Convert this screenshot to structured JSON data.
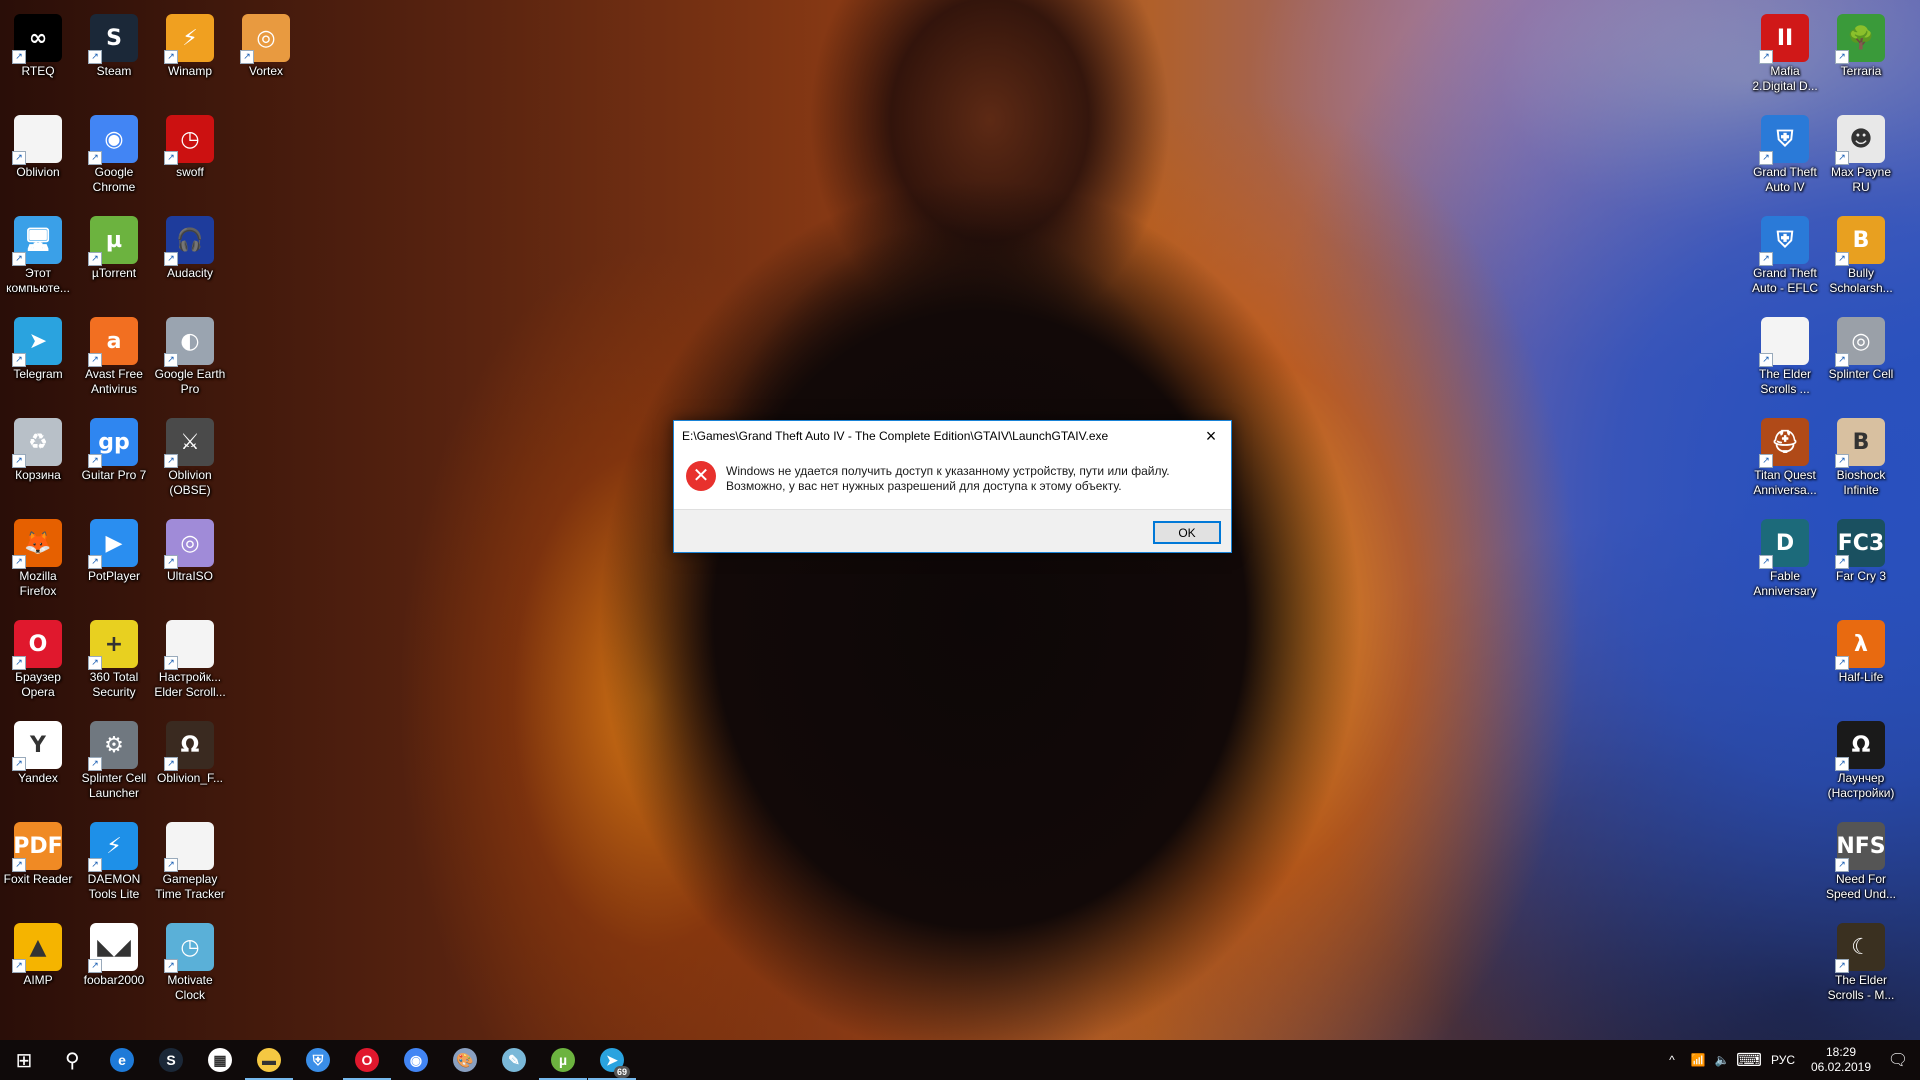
{
  "desktop": {
    "left_icons": [
      {
        "label": "RTEQ",
        "icon": "rteq-equalizer-icon",
        "color": "#000000",
        "glyph": "∞"
      },
      {
        "label": "Steam",
        "icon": "steam-icon",
        "color": "#1b2838",
        "glyph": "S"
      },
      {
        "label": "Winamp",
        "icon": "winamp-icon",
        "color": "#f0a020",
        "glyph": "⚡"
      },
      {
        "label": "Vortex",
        "icon": "vortex-icon",
        "color": "#e89a40",
        "glyph": "◎"
      },
      {
        "label": "Oblivion",
        "icon": "blank-file-icon",
        "color": "#f4f4f4",
        "glyph": ""
      },
      {
        "label": "Google Chrome",
        "icon": "chrome-icon",
        "color": "#4285f4",
        "glyph": "◉"
      },
      {
        "label": "swoff",
        "icon": "swoff-clock-icon",
        "color": "#cc1111",
        "glyph": "◷"
      },
      {
        "label": "Этот компьюте...",
        "icon": "this-pc-icon",
        "color": "#3aa0e8",
        "glyph": "🖥"
      },
      {
        "label": "µTorrent",
        "icon": "utorrent-icon",
        "color": "#6cb33f",
        "glyph": "µ"
      },
      {
        "label": "Audacity",
        "icon": "audacity-icon",
        "color": "#1e3c9c",
        "glyph": "🎧"
      },
      {
        "label": "Telegram",
        "icon": "telegram-icon",
        "color": "#2aa3df",
        "glyph": "➤"
      },
      {
        "label": "Avast Free Antivirus",
        "icon": "avast-icon",
        "color": "#f26f21",
        "glyph": "a"
      },
      {
        "label": "Google Earth Pro",
        "icon": "google-earth-icon",
        "color": "#9aa4b0",
        "glyph": "◐"
      },
      {
        "label": "Корзина",
        "icon": "recycle-bin-icon",
        "color": "#b8c0c8",
        "glyph": "♻"
      },
      {
        "label": "Guitar Pro 7",
        "icon": "guitar-pro-icon",
        "color": "#2f86f0",
        "glyph": "gp"
      },
      {
        "label": "Oblivion (OBSE)",
        "icon": "oblivion-obse-icon",
        "color": "#4a4a4a",
        "glyph": "⚔"
      },
      {
        "label": "Mozilla Firefox",
        "icon": "firefox-icon",
        "color": "#e66000",
        "glyph": "🦊"
      },
      {
        "label": "PotPlayer",
        "icon": "potplayer-icon",
        "color": "#2a8ef0",
        "glyph": "▶"
      },
      {
        "label": "UltraISO",
        "icon": "ultraiso-icon",
        "color": "#a08bd8",
        "glyph": "◎"
      },
      {
        "label": "Браузер Opera",
        "icon": "opera-icon",
        "color": "#e0182d",
        "glyph": "O"
      },
      {
        "label": "360 Total Security",
        "icon": "360-security-icon",
        "color": "#e8d020",
        "glyph": "+"
      },
      {
        "label": "Настройк... Elder Scroll...",
        "icon": "blank-file-icon",
        "color": "#f4f4f4",
        "glyph": ""
      },
      {
        "label": "Yandex",
        "icon": "yandex-browser-icon",
        "color": "#ffffff",
        "glyph": "Y"
      },
      {
        "label": "Splinter Cell Launcher",
        "icon": "gears-launcher-icon",
        "color": "#707880",
        "glyph": "⚙"
      },
      {
        "label": "Oblivion_F...",
        "icon": "oblivion-emblem-icon",
        "color": "#3a2a20",
        "glyph": "Ω"
      },
      {
        "label": "Foxit Reader",
        "icon": "foxit-reader-icon",
        "color": "#f08a24",
        "glyph": "PDF"
      },
      {
        "label": "DAEMON Tools Lite",
        "icon": "daemon-tools-icon",
        "color": "#1e90e8",
        "glyph": "⚡"
      },
      {
        "label": "Gameplay Time Tracker",
        "icon": "blank-file-icon",
        "color": "#f4f4f4",
        "glyph": ""
      },
      {
        "label": "AIMP",
        "icon": "aimp-icon",
        "color": "#f5b400",
        "glyph": "▲"
      },
      {
        "label": "foobar2000",
        "icon": "foobar2000-icon",
        "color": "#ffffff",
        "glyph": "◣◢"
      },
      {
        "label": "Motivate Clock",
        "icon": "motivate-clock-icon",
        "color": "#5ab0d8",
        "glyph": "◷"
      }
    ],
    "right_icons": [
      {
        "label": "Mafia 2.Digital D...",
        "icon": "mafia2-icon",
        "color": "#d01818",
        "glyph": "II"
      },
      {
        "label": "Terraria",
        "icon": "terraria-tree-icon",
        "color": "#3a9a3a",
        "glyph": "🌳"
      },
      {
        "label": "Grand Theft Auto IV",
        "icon": "app-shield-icon",
        "color": "#2a7ad8",
        "glyph": "⛨"
      },
      {
        "label": "Max Payne RU",
        "icon": "max-payne-icon",
        "color": "#e8e8e8",
        "glyph": "☻"
      },
      {
        "label": "Grand Theft Auto - EFLC",
        "icon": "app-shield-icon",
        "color": "#2a7ad8",
        "glyph": "⛨"
      },
      {
        "label": "Bully Scholarsh...",
        "icon": "bully-icon",
        "color": "#e8a020",
        "glyph": "B"
      },
      {
        "label": "The Elder Scrolls ...",
        "icon": "blank-file-icon",
        "color": "#f4f4f4",
        "glyph": ""
      },
      {
        "label": "Splinter Cell",
        "icon": "splinter-cell-icon",
        "color": "#9aa0a8",
        "glyph": "◎"
      },
      {
        "label": "Titan Quest Anniversa...",
        "icon": "titan-quest-helmet-icon",
        "color": "#b04a18",
        "glyph": "⛑"
      },
      {
        "label": "Bioshock Infinite",
        "icon": "bioshock-icon",
        "color": "#d8c0a0",
        "glyph": "B"
      },
      {
        "label": "Fable Anniversary",
        "icon": "fable-icon",
        "color": "#1c6a7a",
        "glyph": "D"
      },
      {
        "label": "Far Cry 3",
        "icon": "far-cry-3-icon",
        "color": "#1a5060",
        "glyph": "FC3"
      },
      {
        "label": "Half-Life",
        "icon": "half-life-icon",
        "color": "#e86a10",
        "glyph": "λ"
      },
      {
        "label": "Лаунчер (Настройки)",
        "icon": "oblivion-launcher-icon",
        "color": "#1a1a1a",
        "glyph": "Ω"
      },
      {
        "label": "Need For Speed Und...",
        "icon": "nfs-icon",
        "color": "#555555",
        "glyph": "NFS"
      },
      {
        "label": "The Elder Scrolls - M...",
        "icon": "morrowind-icon",
        "color": "#3a3020",
        "glyph": "☾"
      }
    ]
  },
  "dialog": {
    "title": "E:\\Games\\Grand Theft Auto IV - The Complete Edition\\GTAIV\\LaunchGTAIV.exe",
    "close_icon": "×",
    "error_icon": "✕",
    "message_line1": "Windows не удается получить доступ к указанному устройству, пути или файлу.",
    "message_line2": "Возможно, у вас нет нужных разрешений для доступа к этому объекту.",
    "ok_label": "OK"
  },
  "taskbar": {
    "start_icon": "⊞",
    "search_icon": "⚲",
    "pinned": [
      {
        "name": "edge",
        "glyph": "e",
        "color": "#1e7ad8",
        "active": false
      },
      {
        "name": "steam",
        "glyph": "S",
        "color": "#1b2838",
        "active": false
      },
      {
        "name": "microsoft-store",
        "glyph": "▦",
        "color": "#ffffff",
        "active": false
      },
      {
        "name": "file-explorer",
        "glyph": "▬",
        "color": "#f5c842",
        "active": true
      },
      {
        "name": "vpn-shield",
        "glyph": "⛨",
        "color": "#3a8ee8",
        "active": false
      },
      {
        "name": "opera",
        "glyph": "O",
        "color": "#e0182d",
        "active": true
      },
      {
        "name": "chrome",
        "glyph": "◉",
        "color": "#4285f4",
        "active": false
      },
      {
        "name": "paint",
        "glyph": "🎨",
        "color": "#8aa0c0",
        "active": false
      },
      {
        "name": "notepad",
        "glyph": "✎",
        "color": "#7ab8d8",
        "active": false
      },
      {
        "name": "utorrent",
        "glyph": "µ",
        "color": "#6cb33f",
        "active": true
      },
      {
        "name": "telegram",
        "glyph": "➤",
        "color": "#2aa3df",
        "active": true,
        "badge": "69"
      }
    ],
    "tray": {
      "chevron": "^",
      "network_icon": "📶",
      "volume_icon": "🔈",
      "keyboard_icon": "⌨",
      "language": "РУС",
      "time": "18:29",
      "date": "06.02.2019",
      "notifications_icon": "🗨"
    }
  }
}
